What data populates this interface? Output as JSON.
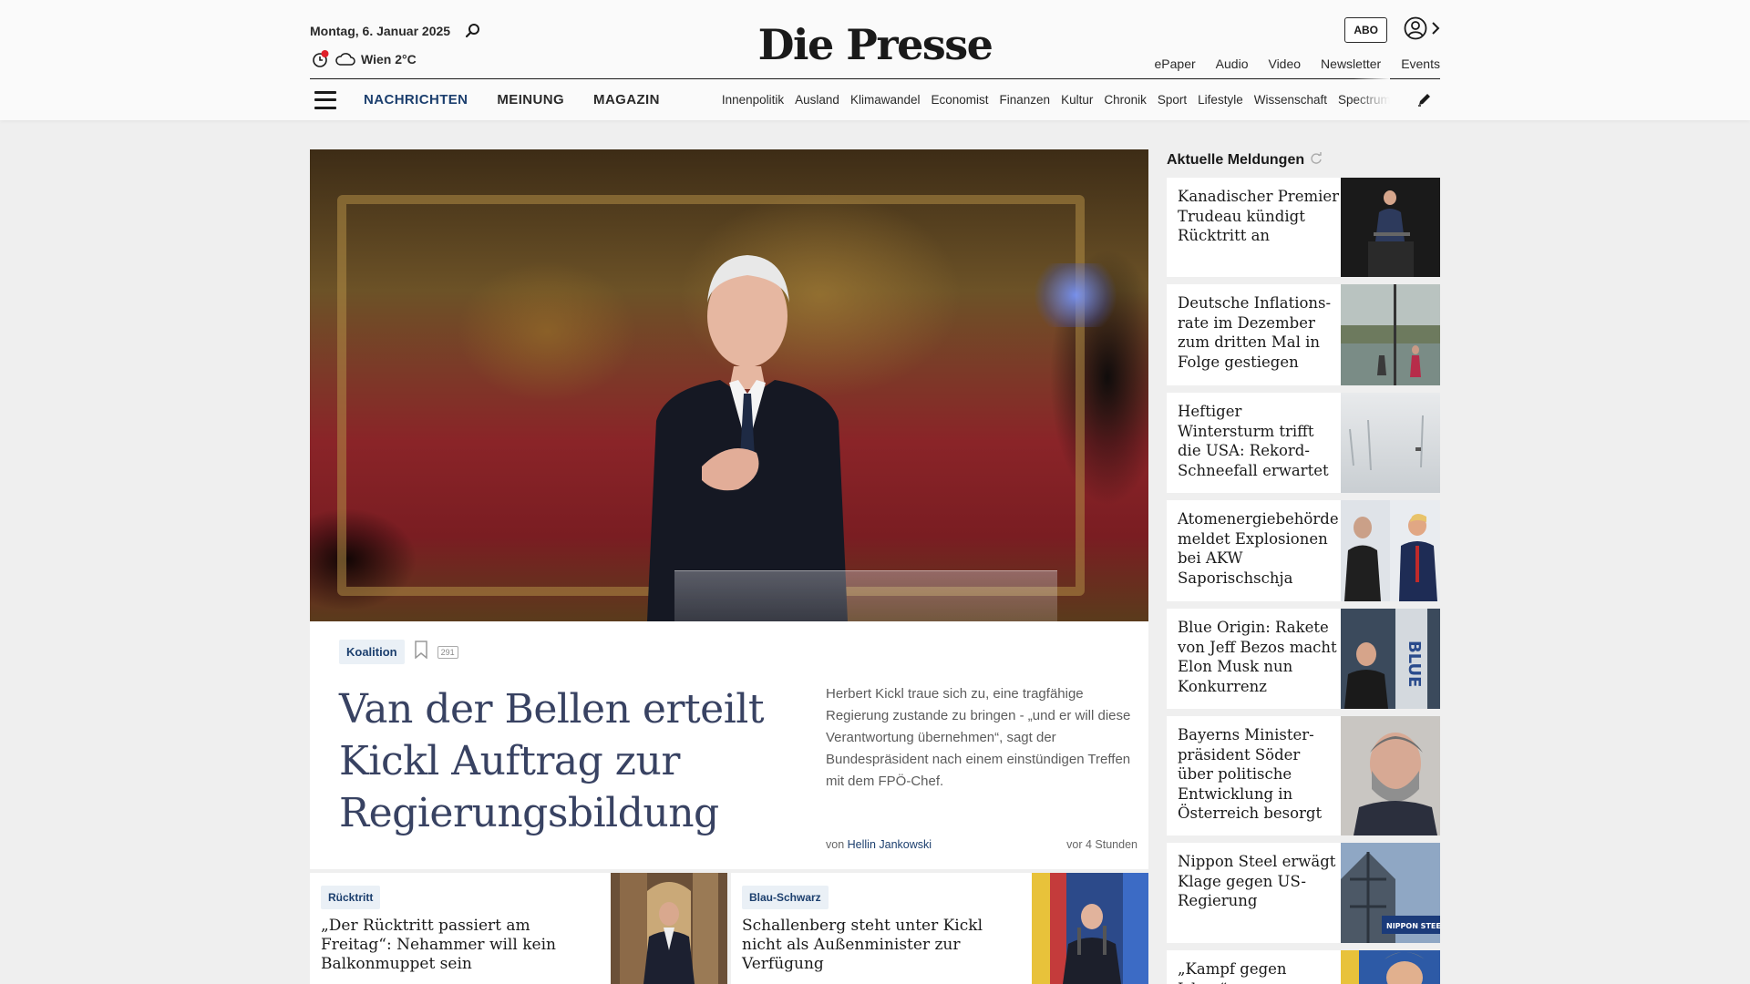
{
  "header": {
    "date": "Montag, 6. Januar 2025",
    "weather": "Wien 2°C",
    "logo": "Die Presse",
    "abo": "ABO",
    "links": [
      "ePaper",
      "Audio",
      "Video",
      "Newsletter",
      "Events"
    ]
  },
  "nav": {
    "main": [
      "NACHRICHTEN",
      "MEINUNG",
      "MAGAZIN"
    ],
    "sub": [
      "Innenpolitik",
      "Ausland",
      "Klimawandel",
      "Economist",
      "Finanzen",
      "Kultur",
      "Chronik",
      "Sport",
      "Lifestyle",
      "Wissenschaft",
      "Spectrum"
    ]
  },
  "hero": {
    "tag": "Koalition",
    "comments": "291",
    "title": "Van der Bellen erteilt Kickl Auftrag zur Regierungsbildung",
    "teaser": "Herbert Kickl traue sich zu, eine tragfähige Regierung zustande zu bringen - „und er will diese Verantwortung übernehmen“, sagt der Bundespräsident nach einem einstündigen Treffen mit dem FPÖ-Chef.",
    "by_prefix": "von",
    "author": "Hellin Jankowski",
    "time": "vor 4 Stunden"
  },
  "cards": [
    {
      "tag": "Rücktritt",
      "title": "„Der Rücktritt passiert am Freitag“: Nehammer will kein Balkonmuppet sein"
    },
    {
      "tag": "Blau-Schwarz",
      "title": "Schallenberg steht unter Kickl nicht als Außenminister zur Verfügung"
    }
  ],
  "sidebar": {
    "title": "Aktuelle Meldungen",
    "items": [
      "Kanadischer Premier Trudeau kündigt Rücktritt an",
      "Deutsche Inflations­rate im Dezember zum dritten Mal in Folge gestiegen",
      "Heftiger Wintersturm trifft die USA: Rekord-Schneefall erwartet",
      "Atomenergiebe­hörde meldet Explosionen bei AKW Saporischschja",
      "Blue Origin: Rakete von Jeff Bezos macht Elon Musk nun Konkurrenz",
      "Bayerns Minister­präsident Söder über politische Entwicklung in Österreich besorgt",
      "Nippon Steel erwägt Klage gegen US-Regierung",
      "„Kampf gegen Islam“:"
    ]
  },
  "colors": {
    "accent": "#1c3f6e",
    "tag_bg": "#eaf0f6",
    "hero_title": "#384262",
    "alert": "#e0202a"
  }
}
